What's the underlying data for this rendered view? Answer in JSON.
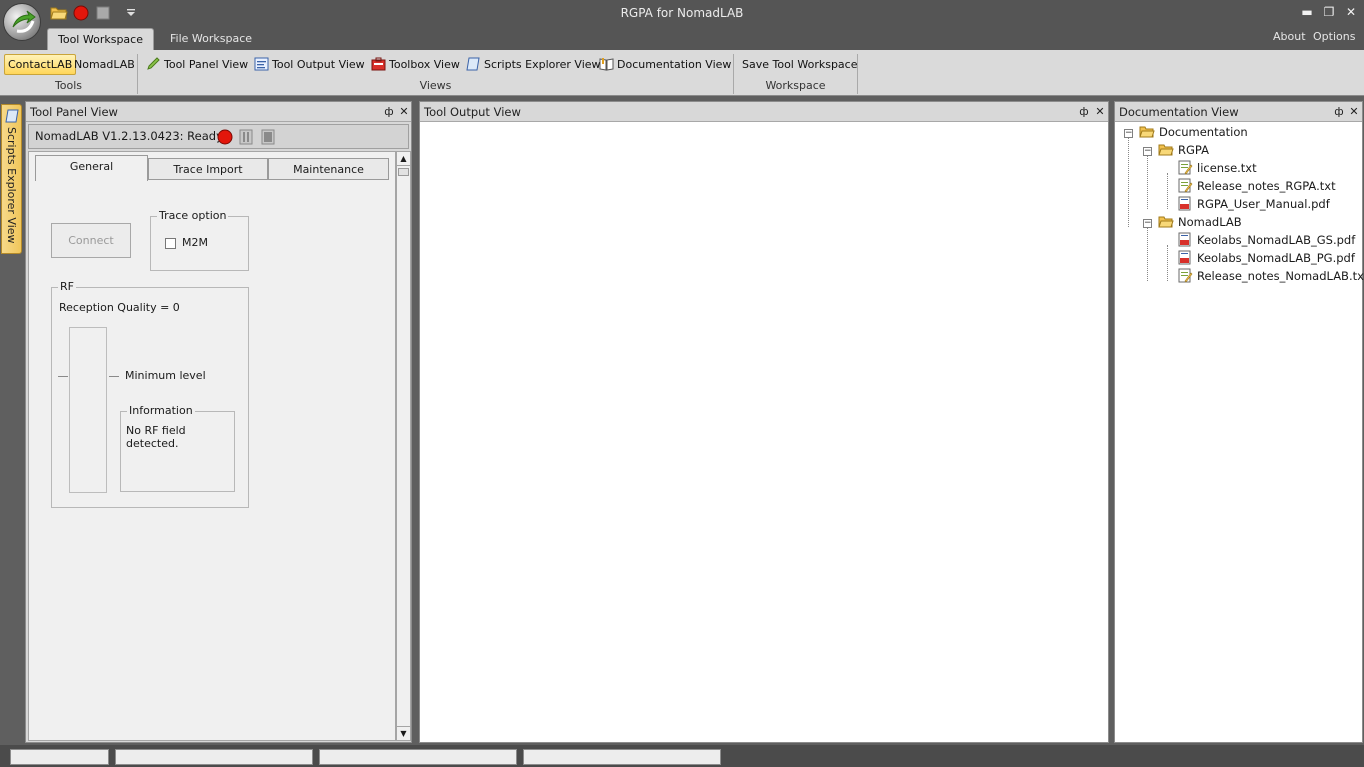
{
  "window": {
    "title": "RGPA for NomadLAB",
    "minimize": "▬",
    "maximize": "❐",
    "close": "✕"
  },
  "ribbon_tabs": [
    {
      "label": "Tool Workspace"
    },
    {
      "label": "File Workspace"
    }
  ],
  "top_links": {
    "about": "About",
    "options": "Options"
  },
  "ribbon": {
    "tools": {
      "contactlab": "ContactLAB",
      "nomadlab": "NomadLAB",
      "group": "Tools"
    },
    "views": {
      "tool_panel": "Tool Panel View",
      "tool_output": "Tool Output View",
      "toolbox": "Toolbox View",
      "scripts_explorer": "Scripts Explorer View",
      "documentation": "Documentation View",
      "group": "Views"
    },
    "workspace": {
      "save": "Save Tool Workspace",
      "group": "Workspace"
    }
  },
  "side_tab": {
    "label": "Scripts Explorer View"
  },
  "tool_panel": {
    "title": "Tool Panel View",
    "pin": "ф",
    "close": "✕",
    "status": "NomadLAB  V1.2.13.0423:  Ready",
    "tabs": [
      {
        "label": "General"
      },
      {
        "label": "Trace Import"
      },
      {
        "label": "Maintenance"
      }
    ],
    "connect": "Connect",
    "trace_option": {
      "title": "Trace option",
      "m2m": "M2M"
    },
    "rf": {
      "title": "RF",
      "reception": "Reception Quality = 0",
      "minimum_level": "Minimum level",
      "info_title": "Information",
      "info_text": "No RF field detected."
    }
  },
  "output_panel": {
    "title": "Tool Output View",
    "pin": "ф",
    "close": "✕"
  },
  "docs_panel": {
    "title": "Documentation View",
    "pin": "ф",
    "close": "✕",
    "tree": {
      "root": "Documentation",
      "rgpa": {
        "label": "RGPA",
        "files": [
          "license.txt",
          "Release_notes_RGPA.txt",
          "RGPA_User_Manual.pdf"
        ]
      },
      "nomadlab": {
        "label": "NomadLAB",
        "files": [
          "Keolabs_NomadLAB_GS.pdf",
          "Keolabs_NomadLAB_PG.pdf",
          "Release_notes_NomadLAB.txt"
        ]
      }
    }
  },
  "colors": {
    "accent": "#ffd65a",
    "chrome": "#555555",
    "ribbon": "#dadada",
    "record": "#e3160b"
  }
}
